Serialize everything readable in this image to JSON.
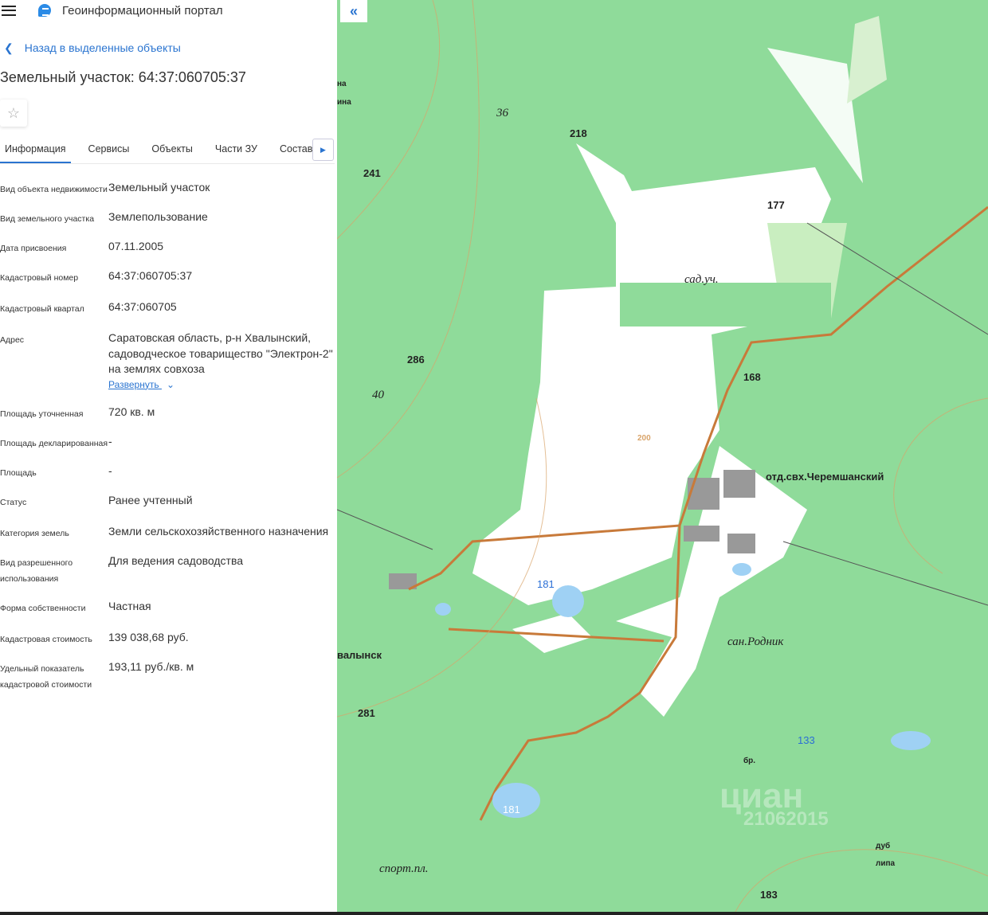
{
  "header": {
    "app_title": "Геоинформационный портал"
  },
  "back_link": "Назад в выделенные объекты",
  "title": "Земельный участок: 64:37:060705:37",
  "tabs": [
    "Информация",
    "Сервисы",
    "Объекты",
    "Части ЗУ",
    "Состав"
  ],
  "fields": [
    {
      "label": "Вид объекта недвижимости",
      "value": "Земельный участок"
    },
    {
      "label": "Вид земельного участка",
      "value": "Землепользование"
    },
    {
      "label": "Дата присвоения",
      "value": "07.11.2005"
    },
    {
      "label": "Кадастровый номер",
      "value": "64:37:060705:37"
    },
    {
      "label": "Кадастровый квартал",
      "value": "64:37:060705"
    },
    {
      "label": "Адрес",
      "value": "Саратовская область, р-н Хвалынский, садоводческое товарищество \"Электрон-2\" на землях совхоза"
    },
    {
      "label": "Площадь уточненная",
      "value": "720 кв. м"
    },
    {
      "label": "Площадь декларированная",
      "value": "-"
    },
    {
      "label": "Площадь",
      "value": "-"
    },
    {
      "label": "Статус",
      "value": "Ранее учтенный"
    },
    {
      "label": "Категория земель",
      "value": "Земли сельскохозяйственного назначения"
    },
    {
      "label": "Вид разрешенного использования",
      "value": "Для ведения садоводства"
    },
    {
      "label": "Форма собственности",
      "value": "Частная"
    },
    {
      "label": "Кадастровая стоимость",
      "value": "139 038,68 руб."
    },
    {
      "label": "Удельный показатель кадастровой стоимости",
      "value": "193,11 руб./кв. м"
    }
  ],
  "expand_label": "Развернуть",
  "map": {
    "labels": {
      "l36": "36",
      "l218": "218",
      "l241": "241",
      "l177": "177",
      "sad": "сад.уч.",
      "l286": "286",
      "l40": "40",
      "l168": "168",
      "otd": "отд.свх.Черемшанский",
      "l181a": "181",
      "hval": "валынск",
      "rodnik": "сан.Родник",
      "l281": "281",
      "l133": "133",
      "br": "бр.",
      "l181b": "181",
      "dub": "дуб",
      "lipa": "липа",
      "sport": "спорт.пл.",
      "l183": "183",
      "l200": "200",
      "na": "на",
      "ina": "ина"
    },
    "watermark": "циан 21062015",
    "colors": {
      "forest": "#8fdb9a",
      "clear": "#ffffff",
      "road": "#c87a3a"
    }
  }
}
